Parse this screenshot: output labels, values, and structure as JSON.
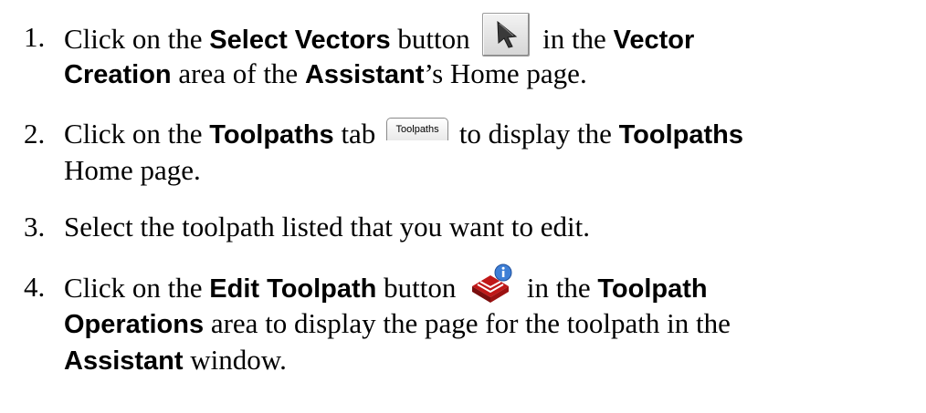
{
  "steps": [
    {
      "number": "1.",
      "line1": {
        "t1": "Click on the ",
        "b1": "Select Vectors",
        "t2": " button ",
        "t3": " in the ",
        "b2": "Vector"
      },
      "line2": {
        "b1": "Creation",
        "t1": " area of the ",
        "b2": "Assistant",
        "t2": "’s Home page."
      }
    },
    {
      "number": "2.",
      "line1": {
        "t1": "Click on the ",
        "b1": "Toolpaths",
        "t2": " tab ",
        "tab_label": "Toolpaths",
        "t3": " to display the ",
        "b2": "Toolpaths"
      },
      "line2": {
        "t1": "Home page."
      }
    },
    {
      "number": "3.",
      "line1": {
        "t1": "Select the toolpath listed that you want to edit."
      }
    },
    {
      "number": "4.",
      "line1": {
        "t1": "Click on the ",
        "b1": "Edit Toolpath",
        "t2": " button ",
        "t3": " in the ",
        "b2": "Toolpath"
      },
      "line2": {
        "b1": "Operations",
        "t1": " area to display the page for the toolpath in the"
      },
      "line3": {
        "b1": "Assistant",
        "t1": " window."
      }
    }
  ],
  "icons": {
    "select_vectors": "arrow-cursor-icon",
    "toolpaths_tab": "tab-icon",
    "edit_toolpath": "toolpath-info-icon"
  }
}
